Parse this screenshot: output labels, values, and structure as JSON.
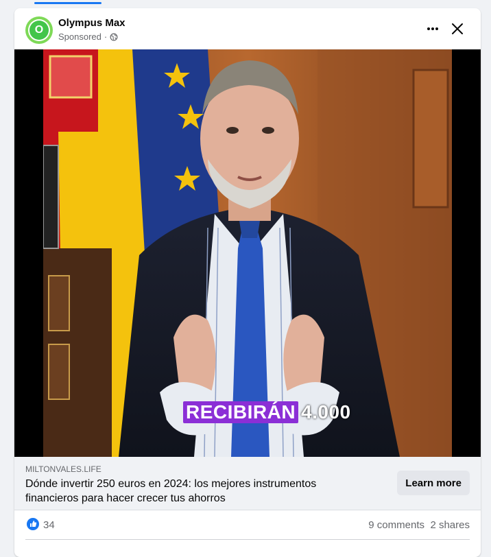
{
  "post": {
    "page_name": "Olympus Max",
    "sponsored_label": "Sponsored",
    "separator": "·",
    "avatar_letter": "O"
  },
  "video": {
    "caption_highlight": "RECIBIRÁN",
    "caption_rest": "4.000"
  },
  "link": {
    "domain": "MILTONVALES.LIFE",
    "headline": "Dónde invertir 250 euros en 2024: los mejores instrumentos financieros para hacer crecer tus ahorros",
    "cta_label": "Learn more"
  },
  "engagement": {
    "reactions_count": "34",
    "comments": "9 comments",
    "shares": "2 shares"
  },
  "colors": {
    "accent": "#1877f2",
    "avatar_green": "#43c54a",
    "caption_highlight": "#8b2fd6"
  }
}
